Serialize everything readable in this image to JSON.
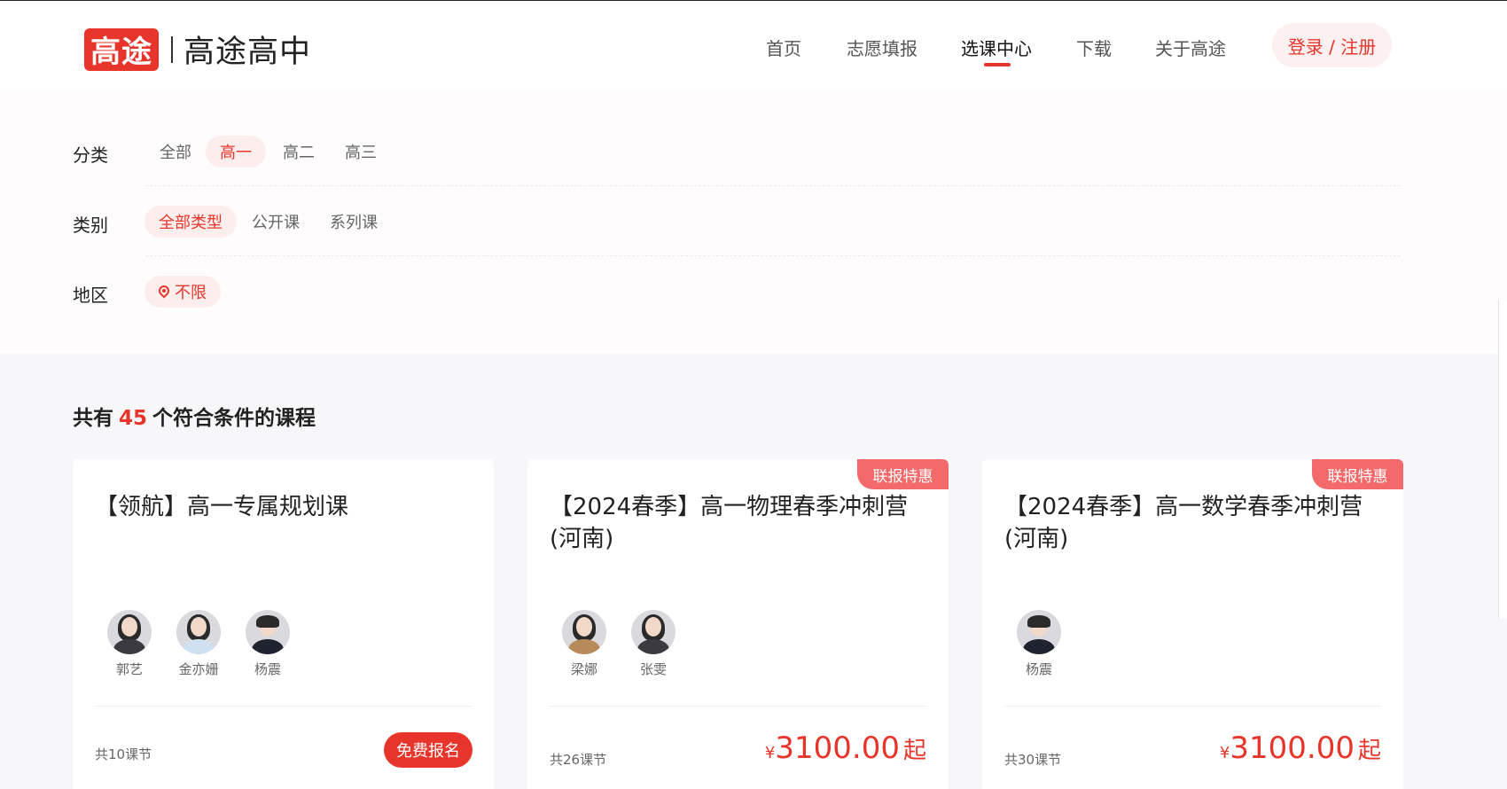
{
  "header": {
    "logo_mark": "高途",
    "logo_name": "高途高中",
    "nav": [
      "首页",
      "志愿填报",
      "选课中心",
      "下载",
      "关于高途"
    ],
    "active_nav": "选课中心",
    "login_label": "登录 / 注册"
  },
  "filters": {
    "category_label": "分类",
    "category_options": [
      "全部",
      "高一",
      "高二",
      "高三"
    ],
    "category_selected": "高一",
    "type_label": "类别",
    "type_options": [
      "全部类型",
      "公开课",
      "系列课"
    ],
    "type_selected": "全部类型",
    "region_label": "地区",
    "region_value": "不限"
  },
  "results": {
    "prefix": "共有",
    "count": "45",
    "suffix": "个符合条件的课程"
  },
  "courses": [
    {
      "title": "【领航】高一专属规划课",
      "badge": "",
      "teachers": [
        "郭艺",
        "金亦姗",
        "杨震"
      ],
      "lessons": "共10课节",
      "action_label": "免费报名"
    },
    {
      "title": "【2024春季】高一物理春季冲刺营(河南)",
      "badge": "联报特惠",
      "teachers": [
        "梁娜",
        "张雯"
      ],
      "lessons": "共26课节",
      "price_currency": "¥",
      "price_amount": "3100.00",
      "price_suffix": "起"
    },
    {
      "title": "【2024春季】高一数学春季冲刺营(河南)",
      "badge": "联报特惠",
      "teachers": [
        "杨震"
      ],
      "lessons": "共30课节",
      "price_currency": "¥",
      "price_amount": "3100.00",
      "price_suffix": "起"
    }
  ],
  "colors": {
    "brand_red": "#e8352b",
    "badge_red": "#f46a6a",
    "chip_bg": "#fdeeee"
  }
}
